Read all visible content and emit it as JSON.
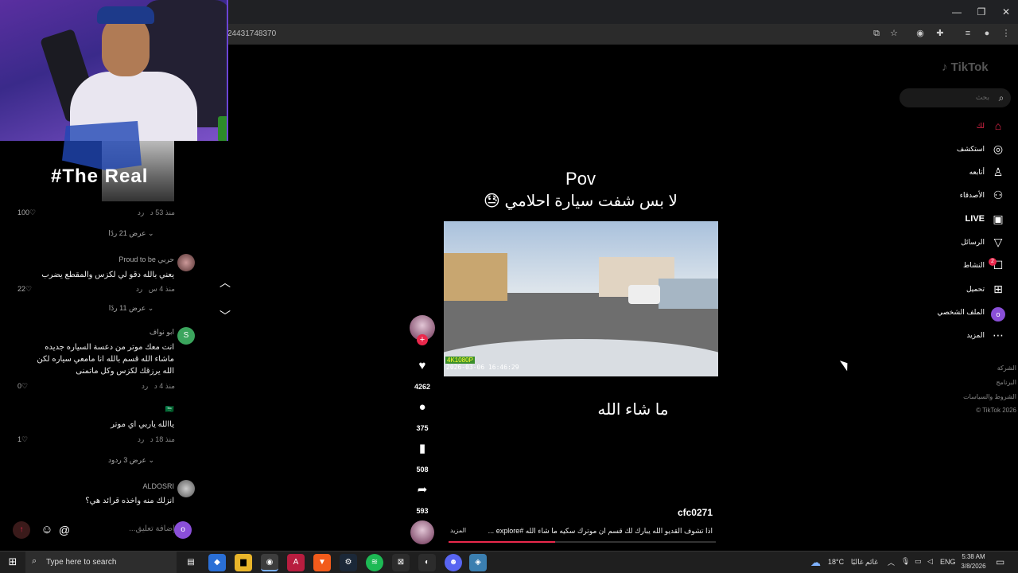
{
  "browser": {
    "url_fragment": "24431748370",
    "window_controls": {
      "minimize": "—",
      "restore": "❐",
      "close": "✕"
    }
  },
  "stream_overlay": {
    "text": "#The Real"
  },
  "comments": [
    {
      "meta": "منذ 53 د",
      "reply": "رد",
      "likes": "100",
      "view_replies": "عرض 21 ردًا"
    },
    {
      "name": "Proud to be حربي",
      "text": "يعني بالله دقو لي لكزس والمقطع يضرب",
      "meta": "منذ 4 س",
      "reply": "رد",
      "likes": "22",
      "view_replies": "عرض 11 ردًا"
    },
    {
      "name": "ابو نواف",
      "avatar_letter": "S",
      "text": "انت معك موتر من دعسة السياره جديده ماشاء الله قسم بالله انا مامعي سياره لكن الله يرزقك لكزس وكل ماتمنى",
      "meta": "منذ 4 د",
      "reply": "رد",
      "likes": "0"
    },
    {
      "name": "🇸🇦",
      "text": "ياالله ياربي اي موتر",
      "meta": "منذ 18 د",
      "reply": "رد",
      "likes": "1",
      "view_replies": "عرض 3 ردود"
    },
    {
      "name": "ALDOSRI",
      "text": "انزلك منه واخذه قرائد هي؟"
    }
  ],
  "comment_input": {
    "placeholder": "إضافة تعليق...",
    "avatar_letter": "o"
  },
  "video": {
    "title": "Pov",
    "subtitle": "لا بس شفت سيارة احلامي 😓",
    "badge": "4K1080P",
    "timestamp": "2026-03-06 16:46:29",
    "caption": "ما شاء الله",
    "username": "cfc0271",
    "description": "اذا تشوف القديو الله يبارك لك قسم ان موترك سكيه ما شاء الله #explore ...",
    "more": "المزيد",
    "progress": 0.4
  },
  "actions": {
    "likes": "4262",
    "comments": "375",
    "saves": "508",
    "shares": "593"
  },
  "tiktok_sidebar": {
    "logo": "TikTok",
    "search_placeholder": "بحث",
    "nav": [
      {
        "label": "لك",
        "icon": "home-icon"
      },
      {
        "label": "استكشف",
        "icon": "compass-icon"
      },
      {
        "label": "أتابعه",
        "icon": "following-icon"
      },
      {
        "label": "الأصدقاء",
        "icon": "friends-icon"
      },
      {
        "label": "LIVE",
        "icon": "live-icon"
      },
      {
        "label": "الرسائل",
        "icon": "messages-icon"
      },
      {
        "label": "النشاط",
        "icon": "inbox-icon",
        "badge": "2"
      },
      {
        "label": "تحميل",
        "icon": "upload-icon"
      },
      {
        "label": "الملف الشخصي",
        "icon": "profile-icon",
        "avatar_letter": "o"
      },
      {
        "label": "المزيد",
        "icon": "more-icon"
      }
    ],
    "footer": [
      "الشركة",
      "البرنامج",
      "الشروط والسياسات",
      "© TikTok 2026"
    ]
  },
  "taskbar": {
    "search_placeholder": "Type here to search",
    "weather": "18°C",
    "weather_text": "غائم غالبًا",
    "language": "ENG",
    "time": "5:38 AM",
    "date": "3/8/2026"
  }
}
